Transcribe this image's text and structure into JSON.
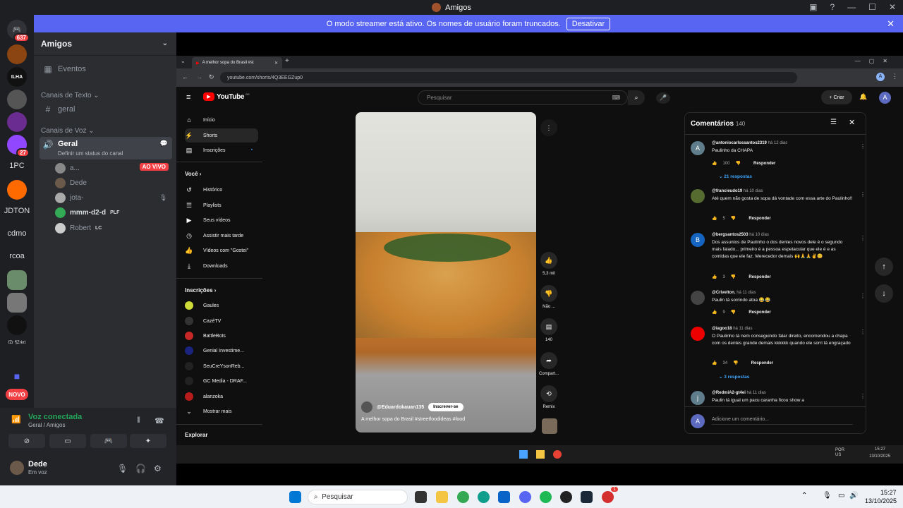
{
  "window": {
    "title": "Amigos"
  },
  "streamer": {
    "text": "O modo streamer está ativo. Os nomes de usuário foram truncados.",
    "button": "Desativar"
  },
  "rail": {
    "badge_top": "637",
    "badge_twitch": "27",
    "texts": [
      "1PC",
      "JDTON",
      "cdmo",
      "rcoa",
      "fZr ¶Zrkrt"
    ],
    "new_label": "NOVO"
  },
  "sidebar": {
    "title": "Amigos",
    "events": "Eventos",
    "text_category": "Canais de Texto",
    "text_channel": "geral",
    "voice_category": "Canais de Voz",
    "voice_channel": "Geral",
    "voice_status": "Definir um status do canal",
    "users": [
      {
        "name": "a...",
        "tag": ""
      },
      {
        "name": "Dede",
        "tag": ""
      },
      {
        "name": "jota-",
        "tag": ""
      },
      {
        "name": "mmm-d2-d",
        "tag": "PLF"
      },
      {
        "name": "Robert",
        "tag": "LC"
      }
    ],
    "live_badge": "AO VIVO"
  },
  "voice_panel": {
    "status": "Voz conectada",
    "location": "Geral / Amigos",
    "user": "Dede",
    "user_status": "Em voz"
  },
  "browser": {
    "tab_title": "A melhor sopa do Brasil #st",
    "url": "youtube.com/shorts/4Q3EEGZup0"
  },
  "youtube": {
    "logo": "YouTube",
    "logo_badge": "BR",
    "search_placeholder": "Pesquisar",
    "create": "Criar",
    "avatar_letter": "A",
    "nav": [
      "Início",
      "Shorts",
      "Inscrições"
    ],
    "you_section": "Você",
    "you_items": [
      "Histórico",
      "Playlists",
      "Seus vídeos",
      "Assistir mais tarde",
      "Vídeos com \"Gostei\"",
      "Downloads"
    ],
    "subs_section": "Inscrições",
    "subs": [
      "Gaules",
      "CazéTV",
      "BattleBots",
      "Genial Investime...",
      "SeuCreYsonReb...",
      "GC Media - DRAF...",
      "alanzoka"
    ],
    "show_more": "Mostrar mais",
    "explore": "Explorar",
    "video": {
      "channel": "@Eduardokauan135",
      "subscribe": "Inscrever-se",
      "title": "A melhor sopa do Brasil #streetfoodideas #food"
    },
    "actions": [
      {
        "icon": "like",
        "label": "5,3 mil"
      },
      {
        "icon": "dislike",
        "label": "Não ..."
      },
      {
        "icon": "comment",
        "label": "140"
      },
      {
        "icon": "share",
        "label": "Compart..."
      },
      {
        "icon": "remix",
        "label": "Remix"
      }
    ],
    "comments_title": "Comentários",
    "comments_count": "140",
    "comments": [
      {
        "avatar": "A",
        "user": "@antoniocarlossantos2319",
        "time": "há 12 dias",
        "text": "Paulinho da CHAPA",
        "likes": "100",
        "replies": "21 respostas",
        "color": "#607d8b"
      },
      {
        "avatar": "",
        "user": "@francieudo19",
        "time": "há 10 dias",
        "text": "Até quem não gosta de sopa dá vontade com essa arte do Paulinho!!",
        "likes": "5",
        "replies": "",
        "color": "#556b2f"
      },
      {
        "avatar": "B",
        "user": "@bergsantos2503",
        "time": "há 10 dias",
        "text": "Dos assuntos de Paulinho o dos dentes novos dele é o segundo mais falado... primeiro é a pessoa espetacular que ele é e as comidas que ele faz. Merecedor demais 🙌🙏🙏✌️😊",
        "likes": "3",
        "replies": "",
        "color": "#1565c0"
      },
      {
        "avatar": "",
        "user": "@Crivelton.",
        "time": "há 11 dias",
        "text": "Paulin tá sorrindo atoa 😂😂",
        "likes": "9",
        "replies": "",
        "color": "#444"
      },
      {
        "avatar": "",
        "user": "@iagoo18",
        "time": "há 11 dias",
        "text": "O Paulinho tá nem conseguindo falar direito, encomendou a chapa com os dentes grande demais kkkkkk quando ele sorri tá engraçado",
        "likes": "34",
        "replies": "3 respostas",
        "color": "#e00"
      },
      {
        "avatar": "j",
        "user": "@RedmiA2-gt4ei",
        "time": "há 11 dias",
        "text": "Paulin tá igual um pacu caranha ficou show a",
        "likes": "",
        "replies": "",
        "color": "#607d8b"
      }
    ],
    "reply_label": "Responder",
    "add_comment": "Adicione um comentário..."
  },
  "inner_taskbar": {
    "lang": "POR\nUS",
    "time": "15:27",
    "date": "13/10/2025"
  },
  "taskbar": {
    "search": "Pesquisar",
    "time": "15:27",
    "date": "13/10/2025",
    "notif": "1"
  }
}
